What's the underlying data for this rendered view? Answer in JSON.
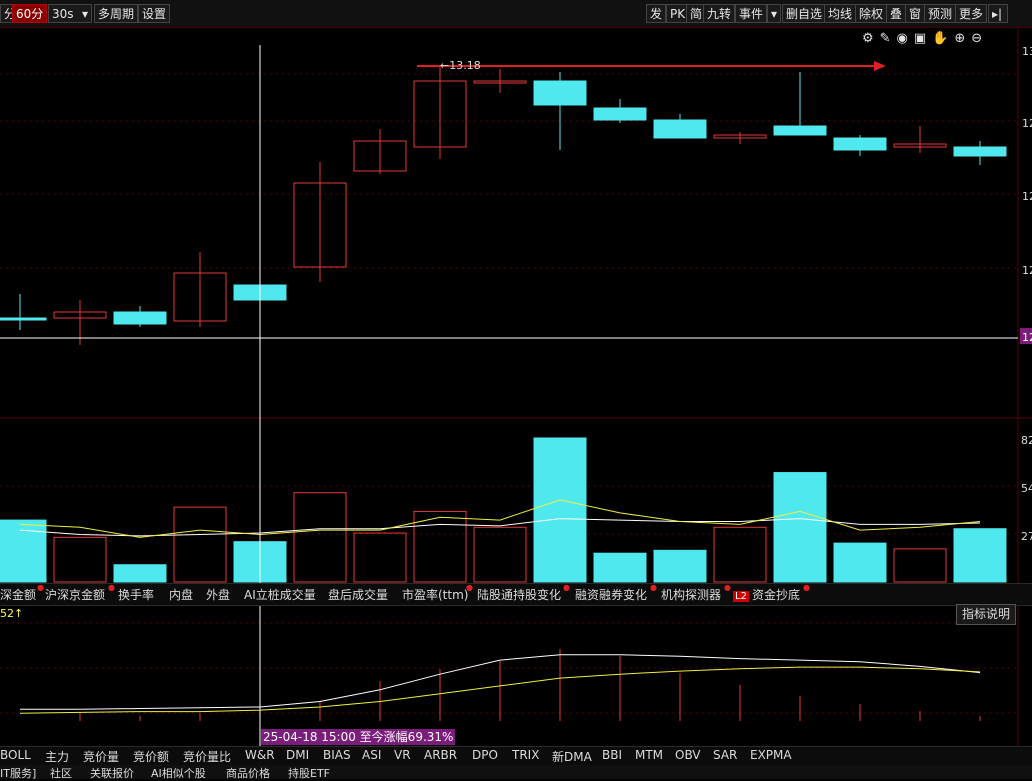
{
  "toolbar": {
    "period_cut": "分",
    "period_60": "60分",
    "interval": "30s",
    "multi_period": "多周期",
    "settings": "设置",
    "right": [
      "发",
      "PK",
      "简",
      "九转",
      "事件",
      "▾",
      "删自选",
      "均线",
      "除权",
      "叠",
      "窗",
      "预测",
      "更多"
    ]
  },
  "price_axis_labels": [
    "13",
    "12",
    "12",
    "12",
    "12"
  ],
  "annotation_high": "←13.18",
  "vol_axis_labels": [
    "82",
    "54",
    "27"
  ],
  "data_tabs": [
    {
      "label": "深金额"
    },
    {
      "label": "沪深京金额"
    },
    {
      "label": "换手率"
    },
    {
      "label": "内盘"
    },
    {
      "label": "外盘"
    },
    {
      "label": "AI立桩成交量"
    },
    {
      "label": "盘后成交量"
    },
    {
      "label": "市盈率(ttm)"
    },
    {
      "label": "陆股通持股变化"
    },
    {
      "label": "融资融券变化"
    },
    {
      "label": "机构探测器"
    },
    {
      "label": "资金抄底"
    }
  ],
  "l2_badge": "L2",
  "indicator_value": "52↑",
  "explain_button": "指标说明",
  "range_text": "25-04-18 15:00 至今涨幅69.31%",
  "indicator_tabs": [
    "BOLL",
    "主力",
    "竞价量",
    "竞价额",
    "竞价量比",
    "W&R",
    "DMI",
    "BIAS",
    "ASI",
    "VR",
    "ARBR",
    "DPO",
    "TRIX",
    "新DMA",
    "BBI",
    "MTM",
    "OBV",
    "SAR",
    "EXPMA"
  ],
  "bottom_tabs": [
    "IT服务]",
    "社区",
    "关联报价",
    "AI相似个股",
    "商品价格",
    "持股ETF"
  ],
  "colors": {
    "up": "#e23a3a",
    "down": "#4fe8ee",
    "ma1": "#ffffff",
    "ma2": "#f0f040",
    "arrow": "#e02020"
  },
  "chart_data": {
    "type": "candlestick",
    "annotation_high": 13.18,
    "candles": [
      {
        "o": 12.34,
        "c": 12.34,
        "h": 12.42,
        "l": 12.3,
        "dir": "down"
      },
      {
        "o": 12.34,
        "c": 12.36,
        "h": 12.4,
        "l": 12.25,
        "dir": "up"
      },
      {
        "o": 12.36,
        "c": 12.32,
        "h": 12.38,
        "l": 12.31,
        "dir": "down"
      },
      {
        "o": 12.33,
        "c": 12.49,
        "h": 12.56,
        "l": 12.31,
        "dir": "up"
      },
      {
        "o": 12.45,
        "c": 12.4,
        "h": 12.48,
        "l": 12.39,
        "dir": "down"
      },
      {
        "o": 12.51,
        "c": 12.79,
        "h": 12.86,
        "l": 12.46,
        "dir": "up"
      },
      {
        "o": 12.83,
        "c": 12.93,
        "h": 12.97,
        "l": 12.82,
        "dir": "up"
      },
      {
        "o": 12.91,
        "c": 13.13,
        "h": 13.18,
        "l": 12.87,
        "dir": "up"
      },
      {
        "o": 13.13,
        "c": 13.13,
        "h": 13.17,
        "l": 13.09,
        "dir": "up"
      },
      {
        "o": 13.13,
        "c": 13.05,
        "h": 13.16,
        "l": 12.9,
        "dir": "down"
      },
      {
        "o": 13.04,
        "c": 13.0,
        "h": 13.07,
        "l": 12.99,
        "dir": "down"
      },
      {
        "o": 13.0,
        "c": 12.94,
        "h": 13.02,
        "l": 12.94,
        "dir": "down"
      },
      {
        "o": 12.94,
        "c": 12.95,
        "h": 12.96,
        "l": 12.92,
        "dir": "up"
      },
      {
        "o": 12.98,
        "c": 12.95,
        "h": 13.16,
        "l": 12.95,
        "dir": "down"
      },
      {
        "o": 12.94,
        "c": 12.9,
        "h": 12.95,
        "l": 12.88,
        "dir": "down"
      },
      {
        "o": 12.92,
        "c": 12.91,
        "h": 12.98,
        "l": 12.89,
        "dir": "up"
      },
      {
        "o": 12.91,
        "c": 12.88,
        "h": 12.93,
        "l": 12.85,
        "dir": "down"
      }
    ],
    "volumes": [
      43,
      31,
      12,
      52,
      28,
      62,
      34,
      49,
      38,
      100,
      20,
      22,
      38,
      76,
      27,
      23,
      37
    ],
    "vol_ma1": [
      36,
      33,
      32,
      33,
      34,
      37,
      37,
      40,
      39,
      44,
      43,
      42,
      42,
      44,
      40,
      40,
      41
    ],
    "vol_ma2": [
      40,
      38,
      31,
      36,
      33,
      36,
      36,
      45,
      43,
      57,
      48,
      42,
      40,
      49,
      36,
      38,
      42
    ],
    "indicator_white": [
      15,
      15,
      16,
      17,
      18,
      25,
      40,
      60,
      78,
      85,
      85,
      83,
      80,
      78,
      76,
      70,
      62
    ],
    "indicator_yellow": [
      10,
      11,
      12,
      12,
      14,
      18,
      25,
      35,
      45,
      55,
      60,
      64,
      67,
      69,
      69,
      67,
      63
    ],
    "indicator_bars": [
      0,
      8,
      5,
      8,
      10,
      20,
      40,
      52,
      60,
      72,
      65,
      48,
      36,
      25,
      17,
      10,
      5
    ]
  }
}
